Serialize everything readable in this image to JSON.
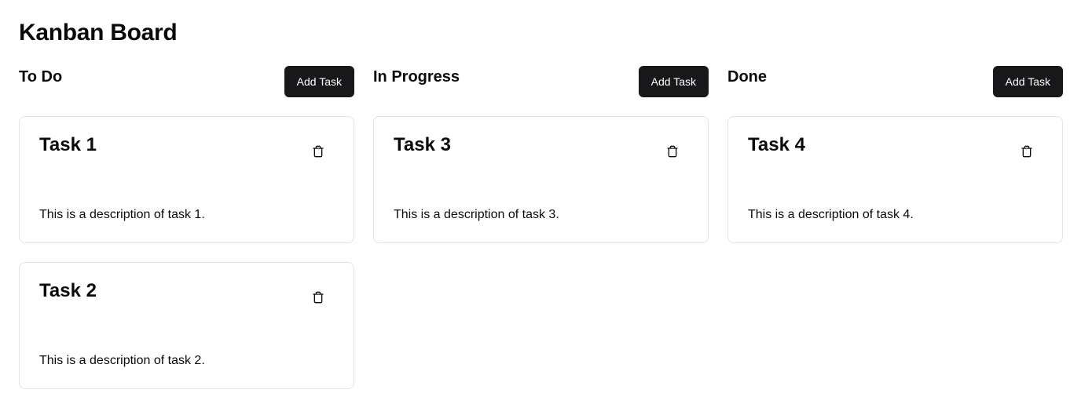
{
  "page": {
    "title": "Kanban Board"
  },
  "columns": [
    {
      "title": "To Do",
      "add_label": "Add Task",
      "cards": [
        {
          "title": "Task 1",
          "description": "This is a description of task 1.",
          "delete_icon": "trash-icon"
        },
        {
          "title": "Task 2",
          "description": "This is a description of task 2.",
          "delete_icon": "trash-icon"
        }
      ]
    },
    {
      "title": "In Progress",
      "add_label": "Add Task",
      "cards": [
        {
          "title": "Task 3",
          "description": "This is a description of task 3.",
          "delete_icon": "trash-icon"
        }
      ]
    },
    {
      "title": "Done",
      "add_label": "Add Task",
      "cards": [
        {
          "title": "Task 4",
          "description": "This is a description of task 4.",
          "delete_icon": "trash-icon"
        }
      ]
    }
  ],
  "colors": {
    "button_bg": "#18181b",
    "button_text": "#ffffff",
    "card_border": "#e4e4e7",
    "text": "#0a0a0a"
  }
}
